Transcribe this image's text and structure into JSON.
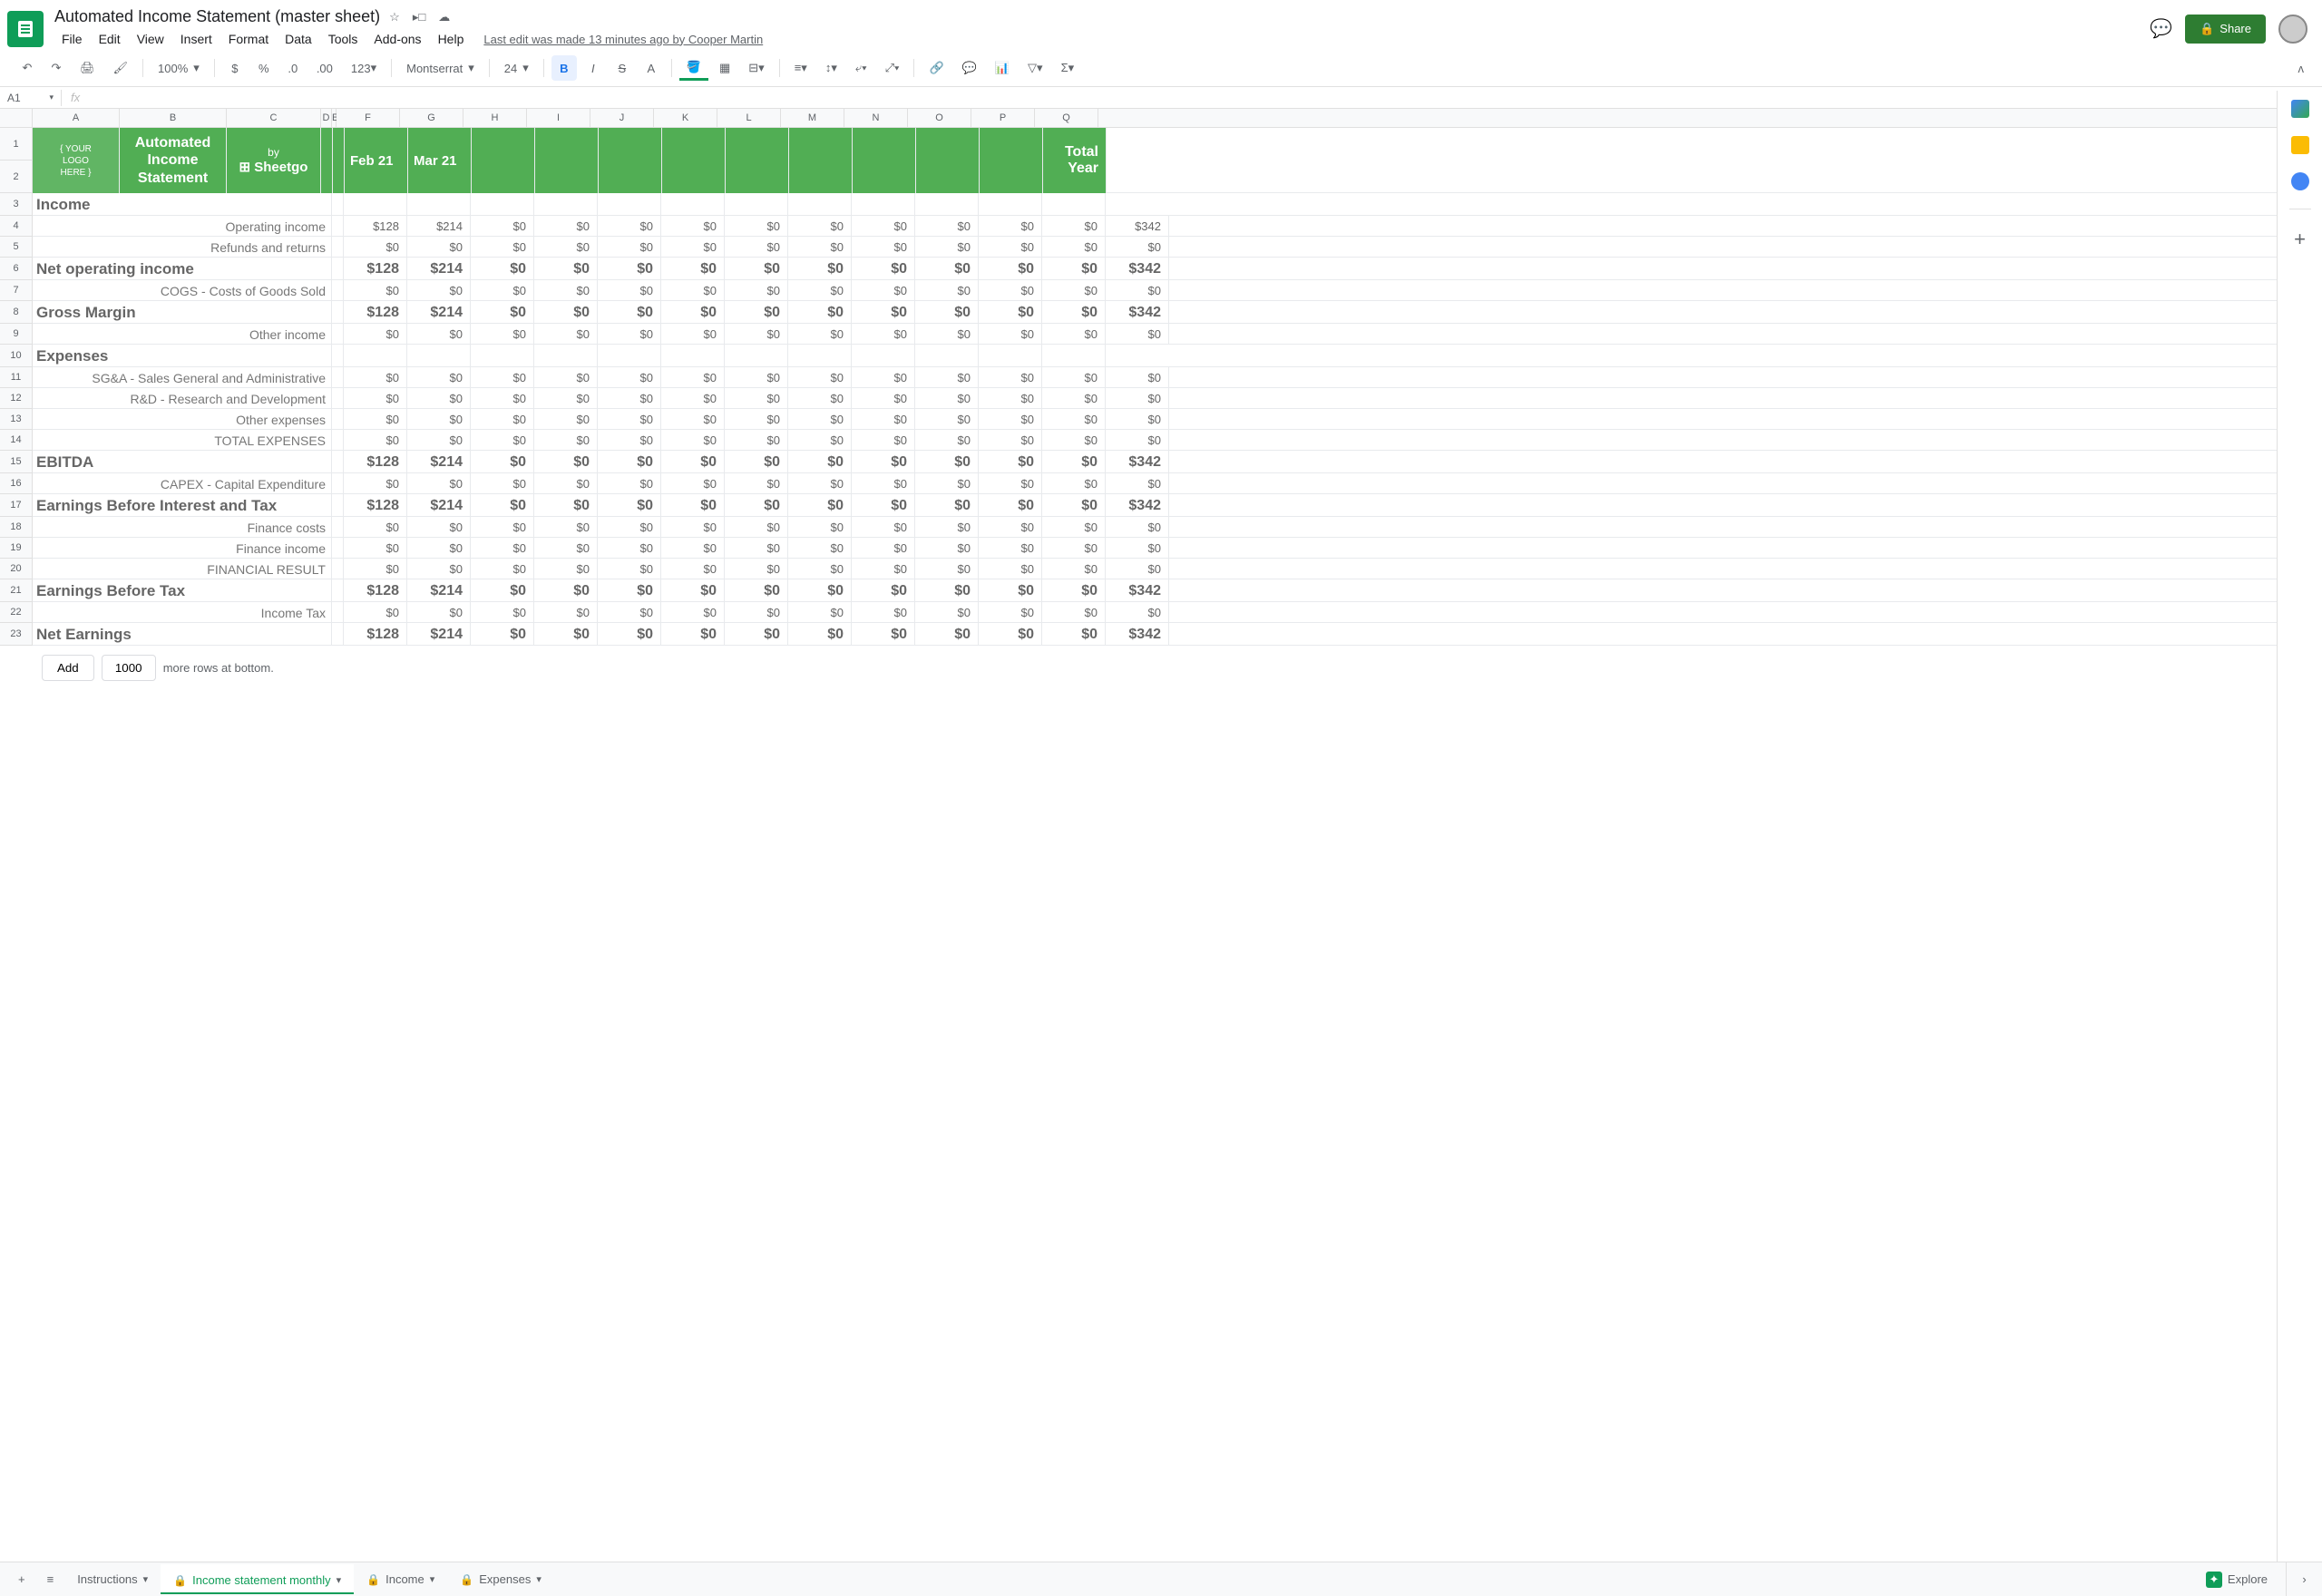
{
  "doc": {
    "title": "Automated Income Statement (master sheet)"
  },
  "menu": [
    "File",
    "Edit",
    "View",
    "Insert",
    "Format",
    "Data",
    "Tools",
    "Add-ons",
    "Help"
  ],
  "last_edit": "Last edit was made 13 minutes ago by Cooper Martin",
  "share": "Share",
  "toolbar": {
    "zoom": "100%",
    "font": "Montserrat",
    "size": "24",
    "numfmt": "123"
  },
  "name_box": "A1",
  "columns": [
    "A",
    "B",
    "C",
    "D",
    "E",
    "F",
    "G",
    "H",
    "I",
    "J",
    "K",
    "L",
    "M",
    "N",
    "O",
    "P",
    "Q"
  ],
  "header": {
    "logo": "{ YOUR LOGO HERE }",
    "title": "Automated Income Statement",
    "by": "by",
    "brand": "Sheetgo",
    "months": [
      "Feb 21",
      "Mar 21"
    ],
    "total": "Total Year"
  },
  "rows": [
    {
      "n": 3,
      "type": "section",
      "label": "Income"
    },
    {
      "n": 4,
      "type": "item",
      "label": "Operating income",
      "vals": [
        "$128",
        "$214",
        "$0",
        "$0",
        "$0",
        "$0",
        "$0",
        "$0",
        "$0",
        "$0",
        "$0",
        "$0",
        "$342"
      ]
    },
    {
      "n": 5,
      "type": "item",
      "label": "Refunds and returns",
      "vals": [
        "$0",
        "$0",
        "$0",
        "$0",
        "$0",
        "$0",
        "$0",
        "$0",
        "$0",
        "$0",
        "$0",
        "$0",
        "$0"
      ]
    },
    {
      "n": 6,
      "type": "bold",
      "label": "Net operating income",
      "vals": [
        "$128",
        "$214",
        "$0",
        "$0",
        "$0",
        "$0",
        "$0",
        "$0",
        "$0",
        "$0",
        "$0",
        "$0",
        "$342"
      ]
    },
    {
      "n": 7,
      "type": "item",
      "label": "COGS - Costs of Goods Sold",
      "vals": [
        "$0",
        "$0",
        "$0",
        "$0",
        "$0",
        "$0",
        "$0",
        "$0",
        "$0",
        "$0",
        "$0",
        "$0",
        "$0"
      ]
    },
    {
      "n": 8,
      "type": "bold",
      "label": "Gross Margin",
      "vals": [
        "$128",
        "$214",
        "$0",
        "$0",
        "$0",
        "$0",
        "$0",
        "$0",
        "$0",
        "$0",
        "$0",
        "$0",
        "$342"
      ]
    },
    {
      "n": 9,
      "type": "item",
      "label": "Other income",
      "vals": [
        "$0",
        "$0",
        "$0",
        "$0",
        "$0",
        "$0",
        "$0",
        "$0",
        "$0",
        "$0",
        "$0",
        "$0",
        "$0"
      ]
    },
    {
      "n": 10,
      "type": "section",
      "label": "Expenses"
    },
    {
      "n": 11,
      "type": "item",
      "label": "SG&A - Sales General and Administrative",
      "vals": [
        "$0",
        "$0",
        "$0",
        "$0",
        "$0",
        "$0",
        "$0",
        "$0",
        "$0",
        "$0",
        "$0",
        "$0",
        "$0"
      ]
    },
    {
      "n": 12,
      "type": "item",
      "label": "R&D - Research and Development",
      "vals": [
        "$0",
        "$0",
        "$0",
        "$0",
        "$0",
        "$0",
        "$0",
        "$0",
        "$0",
        "$0",
        "$0",
        "$0",
        "$0"
      ]
    },
    {
      "n": 13,
      "type": "item",
      "label": "Other expenses",
      "vals": [
        "$0",
        "$0",
        "$0",
        "$0",
        "$0",
        "$0",
        "$0",
        "$0",
        "$0",
        "$0",
        "$0",
        "$0",
        "$0"
      ]
    },
    {
      "n": 14,
      "type": "item",
      "label": "TOTAL EXPENSES",
      "vals": [
        "$0",
        "$0",
        "$0",
        "$0",
        "$0",
        "$0",
        "$0",
        "$0",
        "$0",
        "$0",
        "$0",
        "$0",
        "$0"
      ]
    },
    {
      "n": 15,
      "type": "bold",
      "label": "EBITDA",
      "vals": [
        "$128",
        "$214",
        "$0",
        "$0",
        "$0",
        "$0",
        "$0",
        "$0",
        "$0",
        "$0",
        "$0",
        "$0",
        "$342"
      ]
    },
    {
      "n": 16,
      "type": "item",
      "label": "CAPEX - Capital Expenditure",
      "vals": [
        "$0",
        "$0",
        "$0",
        "$0",
        "$0",
        "$0",
        "$0",
        "$0",
        "$0",
        "$0",
        "$0",
        "$0",
        "$0"
      ]
    },
    {
      "n": 17,
      "type": "bold",
      "label": "Earnings Before Interest and Tax",
      "vals": [
        "$128",
        "$214",
        "$0",
        "$0",
        "$0",
        "$0",
        "$0",
        "$0",
        "$0",
        "$0",
        "$0",
        "$0",
        "$342"
      ]
    },
    {
      "n": 18,
      "type": "item",
      "label": "Finance costs",
      "vals": [
        "$0",
        "$0",
        "$0",
        "$0",
        "$0",
        "$0",
        "$0",
        "$0",
        "$0",
        "$0",
        "$0",
        "$0",
        "$0"
      ]
    },
    {
      "n": 19,
      "type": "item",
      "label": "Finance income",
      "vals": [
        "$0",
        "$0",
        "$0",
        "$0",
        "$0",
        "$0",
        "$0",
        "$0",
        "$0",
        "$0",
        "$0",
        "$0",
        "$0"
      ]
    },
    {
      "n": 20,
      "type": "item",
      "label": "FINANCIAL RESULT",
      "vals": [
        "$0",
        "$0",
        "$0",
        "$0",
        "$0",
        "$0",
        "$0",
        "$0",
        "$0",
        "$0",
        "$0",
        "$0",
        "$0"
      ]
    },
    {
      "n": 21,
      "type": "bold",
      "label": "Earnings Before Tax",
      "vals": [
        "$128",
        "$214",
        "$0",
        "$0",
        "$0",
        "$0",
        "$0",
        "$0",
        "$0",
        "$0",
        "$0",
        "$0",
        "$342"
      ]
    },
    {
      "n": 22,
      "type": "item",
      "label": "Income Tax",
      "vals": [
        "$0",
        "$0",
        "$0",
        "$0",
        "$0",
        "$0",
        "$0",
        "$0",
        "$0",
        "$0",
        "$0",
        "$0",
        "$0"
      ]
    },
    {
      "n": 23,
      "type": "bold",
      "label": "Net Earnings",
      "vals": [
        "$128",
        "$214",
        "$0",
        "$0",
        "$0",
        "$0",
        "$0",
        "$0",
        "$0",
        "$0",
        "$0",
        "$0",
        "$342"
      ]
    }
  ],
  "add_rows": {
    "btn": "Add",
    "count": "1000",
    "suffix": "more rows at bottom."
  },
  "tabs": [
    {
      "label": "Instructions",
      "locked": false,
      "active": false
    },
    {
      "label": "Income statement monthly",
      "locked": true,
      "active": true
    },
    {
      "label": "Income",
      "locked": true,
      "active": false
    },
    {
      "label": "Expenses",
      "locked": true,
      "active": false
    }
  ],
  "explore": "Explore"
}
